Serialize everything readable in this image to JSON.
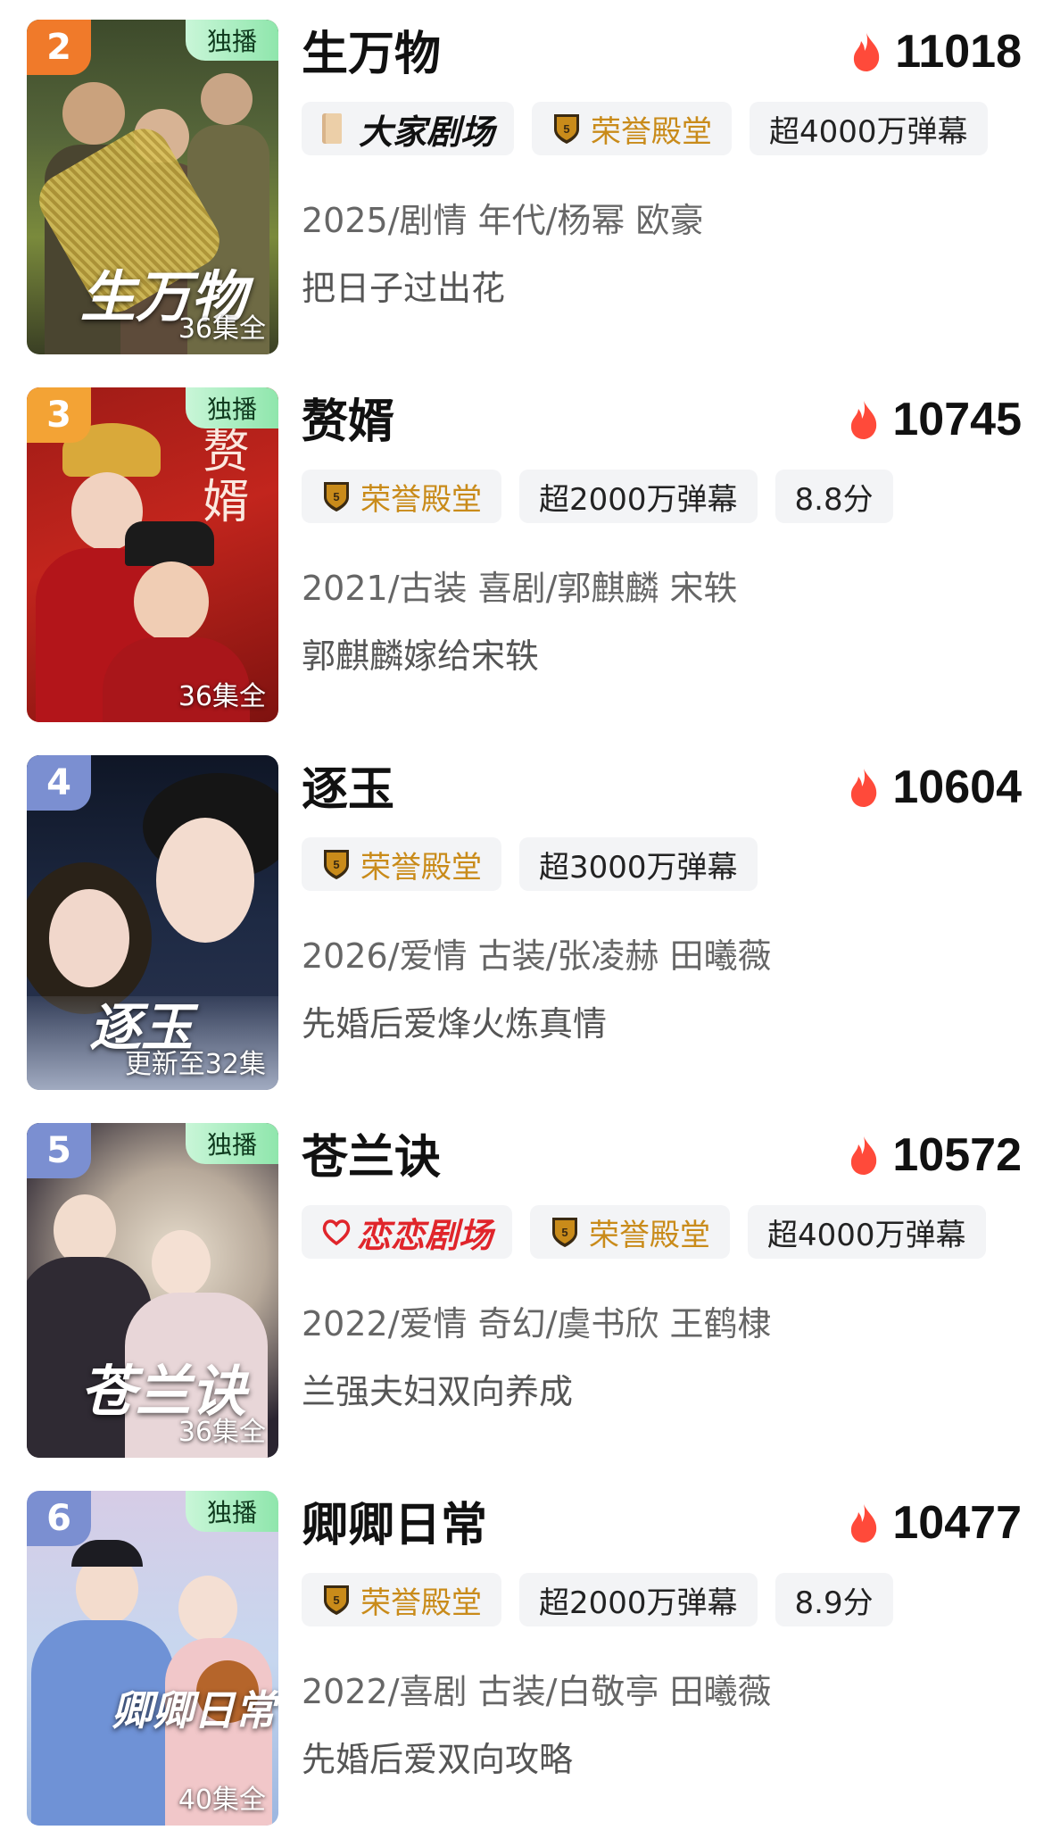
{
  "colors": {
    "rank2": "#f07a2a",
    "rank3": "#f3a335",
    "rank_default": "#7b8fd1",
    "heat_icon": "#ff4a3a",
    "honor_gold": "#c98b1a",
    "lianlian_red": "#e0252b"
  },
  "items": [
    {
      "rank": "2",
      "exclusive": "独播",
      "poster_title": "生万物",
      "episodes": "36集全",
      "title": "生万物",
      "heat": "11018",
      "tags": [
        {
          "kind": "dajia",
          "label": "大家剧场",
          "icon": "book-icon"
        },
        {
          "kind": "honor",
          "label": "荣誉殿堂",
          "icon": "medal-icon"
        },
        {
          "kind": "plain",
          "label": "超4000万弹幕"
        }
      ],
      "meta": "2025/剧情 年代/杨幂 欧豪",
      "desc": "把日子过出花"
    },
    {
      "rank": "3",
      "exclusive": "独播",
      "poster_title": "赘婿",
      "episodes": "36集全",
      "title": "赘婿",
      "heat": "10745",
      "tags": [
        {
          "kind": "honor",
          "label": "荣誉殿堂",
          "icon": "medal-icon"
        },
        {
          "kind": "plain",
          "label": "超2000万弹幕"
        },
        {
          "kind": "plain",
          "label": "8.8分"
        }
      ],
      "meta": "2021/古装 喜剧/郭麒麟 宋轶",
      "desc": "郭麒麟嫁给宋轶"
    },
    {
      "rank": "4",
      "exclusive": "",
      "poster_title": "逐玉",
      "episodes": "更新至32集",
      "title": "逐玉",
      "heat": "10604",
      "tags": [
        {
          "kind": "honor",
          "label": "荣誉殿堂",
          "icon": "medal-icon"
        },
        {
          "kind": "plain",
          "label": "超3000万弹幕"
        }
      ],
      "meta": "2026/爱情 古装/张凌赫 田曦薇",
      "desc": "先婚后爱烽火炼真情"
    },
    {
      "rank": "5",
      "exclusive": "独播",
      "poster_title": "苍兰诀",
      "episodes": "36集全",
      "title": "苍兰诀",
      "heat": "10572",
      "tags": [
        {
          "kind": "lianlian",
          "label": "恋恋剧场",
          "icon": "heart-icon"
        },
        {
          "kind": "honor",
          "label": "荣誉殿堂",
          "icon": "medal-icon"
        },
        {
          "kind": "plain",
          "label": "超4000万弹幕"
        }
      ],
      "meta": "2022/爱情 奇幻/虞书欣 王鹤棣",
      "desc": "兰强夫妇双向养成"
    },
    {
      "rank": "6",
      "exclusive": "独播",
      "poster_title": "卿卿日常",
      "episodes": "40集全",
      "title": "卿卿日常",
      "heat": "10477",
      "tags": [
        {
          "kind": "honor",
          "label": "荣誉殿堂",
          "icon": "medal-icon"
        },
        {
          "kind": "plain",
          "label": "超2000万弹幕"
        },
        {
          "kind": "plain",
          "label": "8.9分"
        }
      ],
      "meta": "2022/喜剧 古装/白敬亭 田曦薇",
      "desc": "先婚后爱双向攻略"
    }
  ]
}
